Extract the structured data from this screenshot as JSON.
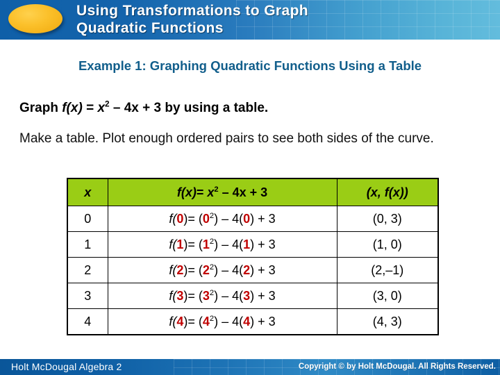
{
  "header": {
    "title": "Using Transformations to Graph\nQuadratic Functions",
    "accent_ellipse_color": "#F5B820",
    "bar_color_left": "#0F5FA8",
    "bar_color_right": "#63BCDD"
  },
  "slide": {
    "subtitle": "Example 1: Graphing Quadratic Functions Using a Table",
    "subtitle_color": "#115E8B",
    "prompt_prefix": "Graph ",
    "prompt_fx": "f(x)",
    "prompt_equals": " = ",
    "prompt_x": "x",
    "prompt_exp": "2",
    "prompt_rest": " – 4x + 3 by using a table.",
    "body_text": "Make a table. Plot enough ordered pairs to see both sides of the curve."
  },
  "table": {
    "header_bg": "#9ACD15",
    "highlight_color": "#C00000",
    "columns": [
      {
        "label_x": "x"
      },
      {
        "label_fx": "f(x)",
        "label_eq": "= ",
        "label_x2": "x",
        "label_exp": "2",
        "label_rest": " – 4x + 3"
      },
      {
        "label_pair": "(x, f(x))"
      }
    ],
    "rows": [
      {
        "x": "0",
        "f_prefix": "f(",
        "f_sub": "0",
        "f_mid1": ")= (",
        "f_sub2": "0",
        "f_exp": "2",
        "f_mid2": ") – 4(",
        "f_sub3": "0",
        "f_suffix": ") + 3",
        "pair": "(0, 3)"
      },
      {
        "x": "1",
        "f_prefix": "f(",
        "f_sub": "1",
        "f_mid1": ")= (",
        "f_sub2": "1",
        "f_exp": "2",
        "f_mid2": ") – 4(",
        "f_sub3": "1",
        "f_suffix": ") + 3",
        "pair": "(1, 0)"
      },
      {
        "x": "2",
        "f_prefix": "f(",
        "f_sub": "2",
        "f_mid1": ")= (",
        "f_sub2": "2",
        "f_exp": "2",
        "f_mid2": ") – 4(",
        "f_sub3": "2",
        "f_suffix": ") + 3",
        "pair": "(2,–1)"
      },
      {
        "x": "3",
        "f_prefix": "f(",
        "f_sub": "3",
        "f_mid1": ")= (",
        "f_sub2": "3",
        "f_exp": "2",
        "f_mid2": ") – 4(",
        "f_sub3": "3",
        "f_suffix": ") + 3",
        "pair": "(3, 0)"
      },
      {
        "x": "4",
        "f_prefix": "f(",
        "f_sub": "4",
        "f_mid1": ")= (",
        "f_sub2": "4",
        "f_exp": "2",
        "f_mid2": ") – 4(",
        "f_sub3": "4",
        "f_suffix": ") + 3",
        "pair": "(4, 3)"
      }
    ]
  },
  "footer": {
    "left": "Holt McDougal Algebra 2",
    "right": "Copyright © by Holt McDougal. All Rights Reserved."
  }
}
